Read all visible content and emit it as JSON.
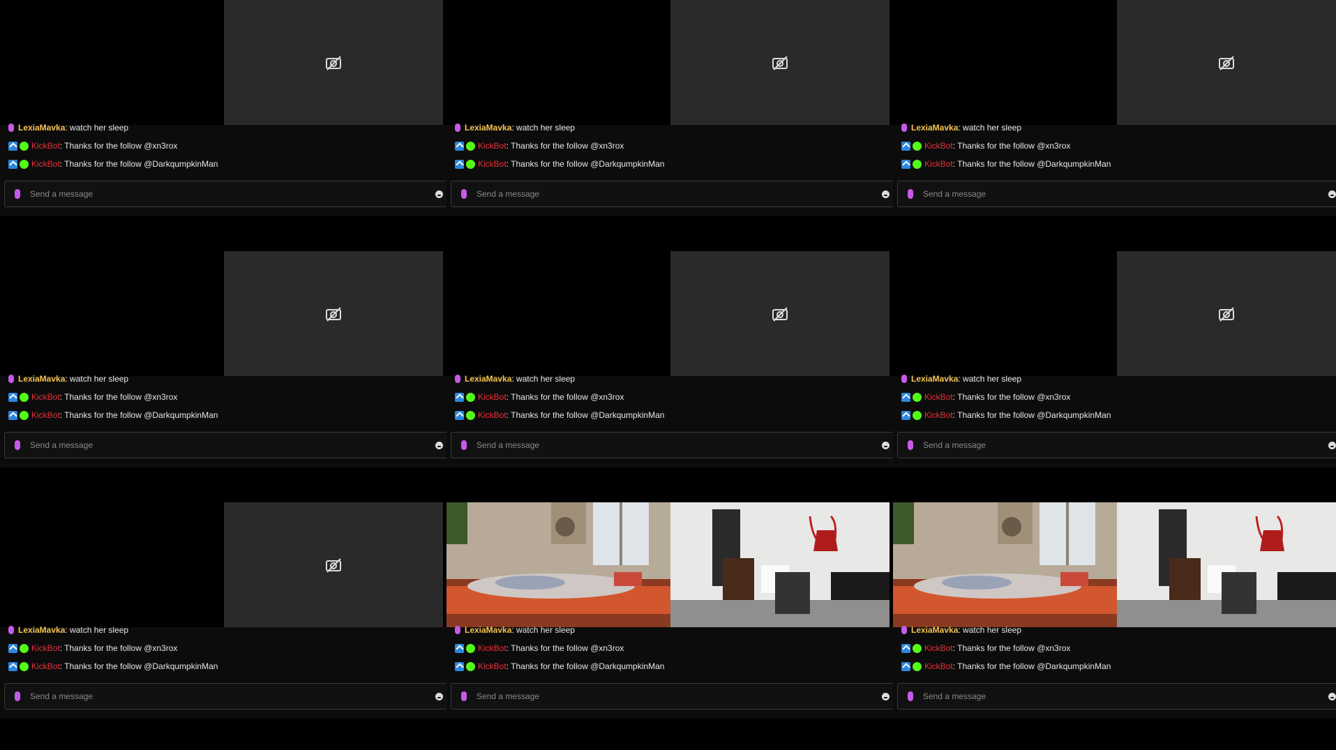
{
  "messages": [
    {
      "user": "LexiaMavka",
      "text": ": watch her sleep"
    },
    {
      "user": "KickBot",
      "text": ": Thanks for the follow @xn3rox"
    },
    {
      "user": "KickBot",
      "text": ": Thanks for the follow @DarkqumpkinMan"
    }
  ],
  "input": {
    "placeholder": "Send a message"
  },
  "icons": {
    "camera_off": "camera-off-icon",
    "mic": "mic-icon",
    "emoji": "emoji-icon"
  },
  "colors": {
    "lexia": "#f4c24f",
    "kickbot": "#e8323c",
    "mic": "#c65ae8",
    "verified": "#53fc18"
  }
}
